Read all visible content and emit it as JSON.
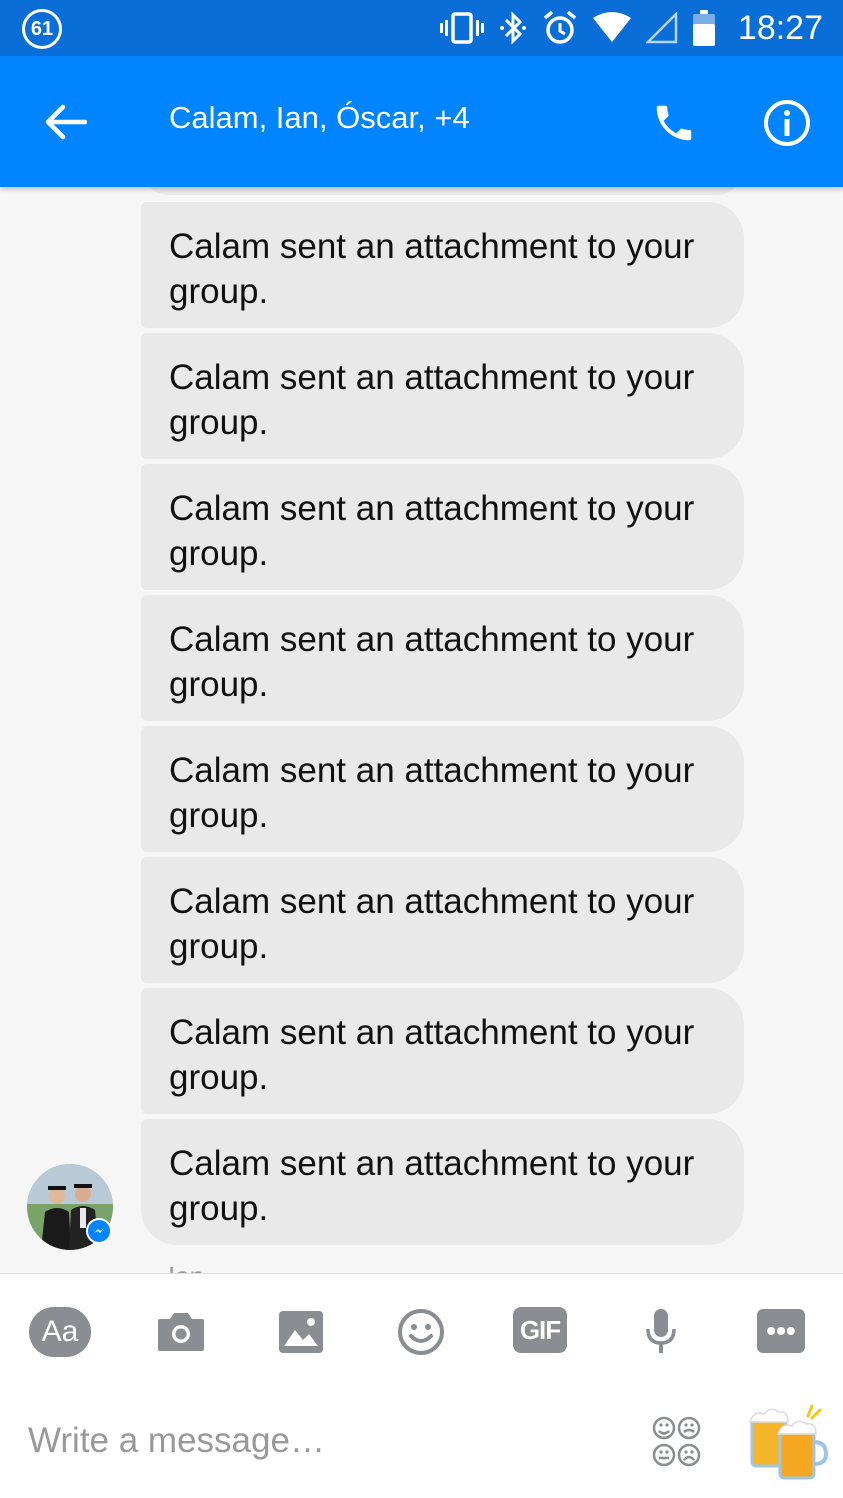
{
  "status_bar": {
    "notification_count": "61",
    "time": "18:27",
    "icons": [
      "vibrate-icon",
      "bluetooth-icon",
      "alarm-icon",
      "wifi-icon",
      "signal-icon",
      "battery-icon"
    ]
  },
  "header": {
    "title": "Calam, Ian, Óscar, +4",
    "icons": [
      "back-arrow-icon",
      "phone-icon",
      "info-icon"
    ]
  },
  "messages": [
    {
      "text": "Calam sent an attachment to your group."
    },
    {
      "text": "Calam sent an attachment to your group."
    },
    {
      "text": "Calam sent an attachment to your group."
    },
    {
      "text": "Calam sent an attachment to your group."
    },
    {
      "text": "Calam sent an attachment to your group."
    },
    {
      "text": "Calam sent an attachment to your group."
    },
    {
      "text": "Calam sent an attachment to your group."
    },
    {
      "text": "Calam sent an attachment to your group."
    }
  ],
  "next_sender": "Ian",
  "composer": {
    "aa_label": "Aa",
    "gif_label": "GIF",
    "more_label": "•••",
    "placeholder": "Write a message…",
    "icons": [
      "camera-icon",
      "image-icon",
      "emoji-icon",
      "microphone-icon",
      "stickers-icon",
      "beer-like-icon"
    ]
  },
  "colors": {
    "header": "#0084ff",
    "status_bar": "#0a6ed8",
    "bubble": "#e9e9e9",
    "toolbar_icon": "#8a8d91"
  }
}
